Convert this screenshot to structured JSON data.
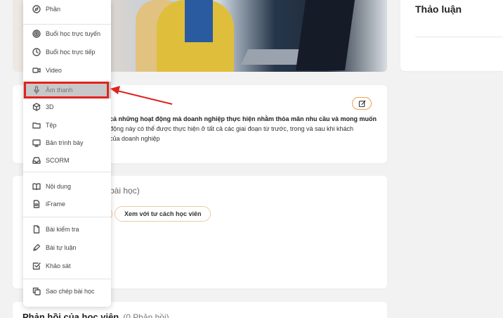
{
  "right_panel": {
    "title": "Thảo luận"
  },
  "description": {
    "line1": "cả những hoạt động mà doanh nghiệp thực hiện nhằm thỏa mãn nhu cầu và mong muốn",
    "line2": "động này có thể được thực hiện ở tất cả các giai đoạn từ trước, trong và sau khi khách",
    "line3": "của doanh nghiệp"
  },
  "content": {
    "title_suffix": "bài học)",
    "view_as_student": "Xem với tư cách học viên"
  },
  "feedback": {
    "title": "Phản hồi của học viên",
    "count": "(0 Phản hồi)"
  },
  "menu": {
    "items": [
      {
        "label": "Phần",
        "icon": "compass-icon"
      },
      {
        "label": "Buổi học trực tuyến",
        "icon": "target-icon"
      },
      {
        "label": "Buổi học trực tiếp",
        "icon": "clock-icon"
      },
      {
        "label": "Video",
        "icon": "video-icon"
      },
      {
        "label": "Âm thanh",
        "icon": "microphone-icon"
      },
      {
        "label": "3D",
        "icon": "cube-icon"
      },
      {
        "label": "Tệp",
        "icon": "folder-icon"
      },
      {
        "label": "Bản trình bày",
        "icon": "monitor-icon"
      },
      {
        "label": "SCORM",
        "icon": "inbox-icon"
      },
      {
        "label": "Nội dung",
        "icon": "book-icon"
      },
      {
        "label": "iFrame",
        "icon": "file-icon"
      },
      {
        "label": "Bài kiểm tra",
        "icon": "document-icon"
      },
      {
        "label": "Bài tự luận",
        "icon": "pen-icon"
      },
      {
        "label": "Khảo sát",
        "icon": "checkbox-icon"
      },
      {
        "label": "Sao chép bài học",
        "icon": "copy-icon"
      }
    ]
  },
  "annotation_color": "#e0231e",
  "accent_color": "#f0a04a"
}
